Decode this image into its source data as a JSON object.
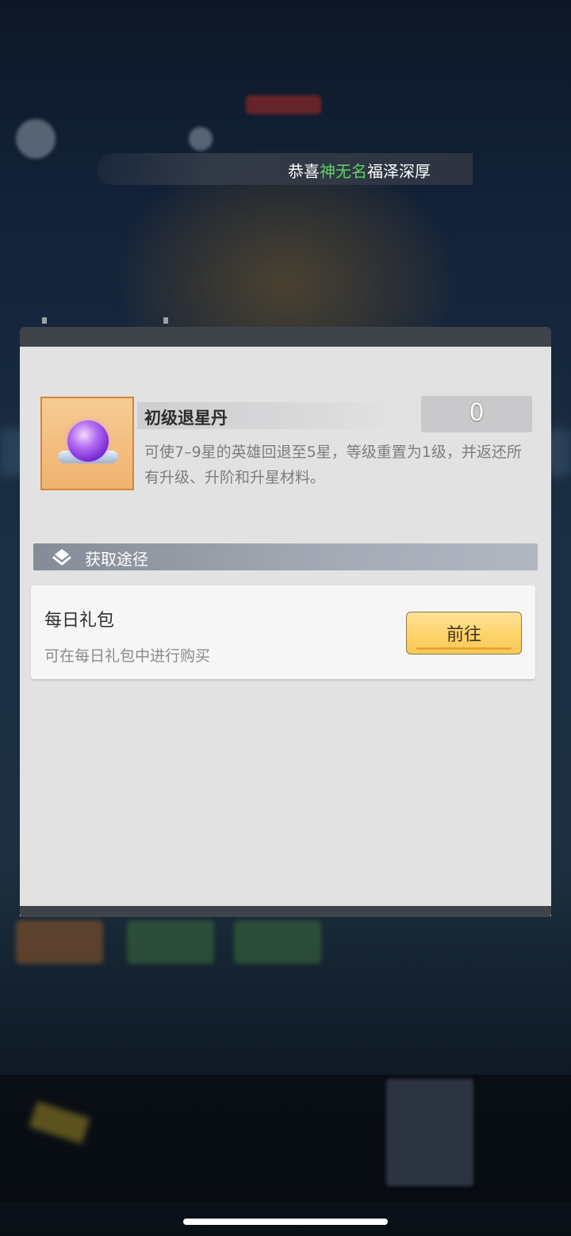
{
  "colors": {
    "marquee_highlight": "#5fd06a",
    "button_fill": "#ffd36b",
    "panel_frame": "#3f434a",
    "panel_body": "#e2e2e2"
  },
  "marquee": {
    "prefix": "恭喜",
    "player_name": "神无名",
    "suffix": "福泽深厚"
  },
  "item": {
    "icon": "purple-orb-icon",
    "name": "初级退星丹",
    "count": "0",
    "description": "可使7–9星的英雄回退至5星，等级重置为1级，并返还所有升级、升阶和升星材料。"
  },
  "section": {
    "icon": "layers-icon",
    "title": "获取途径"
  },
  "sources": [
    {
      "title": "每日礼包",
      "subtitle": "可在每日礼包中进行购买",
      "button_label": "前往"
    }
  ]
}
